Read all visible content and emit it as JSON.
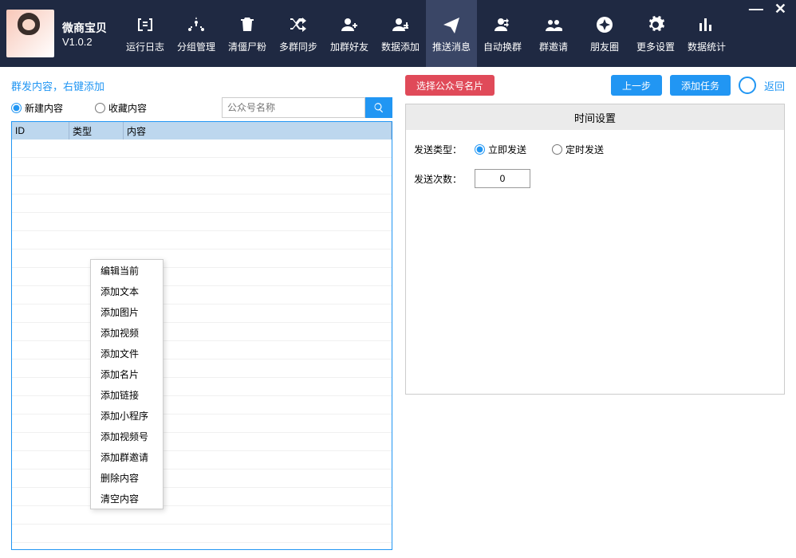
{
  "app": {
    "name": "微商宝贝",
    "version": "V1.0.2"
  },
  "toolbar": [
    {
      "label": "运行日志",
      "icon": "log"
    },
    {
      "label": "分组管理",
      "icon": "group"
    },
    {
      "label": "清僵尸粉",
      "icon": "trash"
    },
    {
      "label": "多群同步",
      "icon": "shuffle"
    },
    {
      "label": "加群好友",
      "icon": "adduser"
    },
    {
      "label": "数据添加",
      "icon": "adduser2"
    },
    {
      "label": "推送消息",
      "icon": "send",
      "active": true
    },
    {
      "label": "自动换群",
      "icon": "userswap"
    },
    {
      "label": "群邀请",
      "icon": "invite"
    },
    {
      "label": "朋友圈",
      "icon": "moments"
    },
    {
      "label": "更多设置",
      "icon": "gear"
    },
    {
      "label": "数据统计",
      "icon": "stats"
    }
  ],
  "left": {
    "heading": "群发内容，右键添加",
    "radio_new": "新建内容",
    "radio_fav": "收藏内容",
    "search_placeholder": "公众号名称",
    "columns": {
      "id": "ID",
      "type": "类型",
      "content": "内容"
    }
  },
  "context_menu": [
    "编辑当前",
    "添加文本",
    "添加图片",
    "添加视频",
    "添加文件",
    "添加名片",
    "添加链接",
    "添加小程序",
    "添加视频号",
    "添加群邀请",
    "删除内容",
    "清空内容"
  ],
  "right": {
    "select_card": "选择公众号名片",
    "prev_step": "上一步",
    "add_task": "添加任务",
    "back": "返回",
    "settings_title": "时间设置",
    "send_type_label": "发送类型：",
    "send_now": "立即发送",
    "send_scheduled": "定时发送",
    "send_count_label": "发送次数：",
    "send_count_value": "0"
  }
}
